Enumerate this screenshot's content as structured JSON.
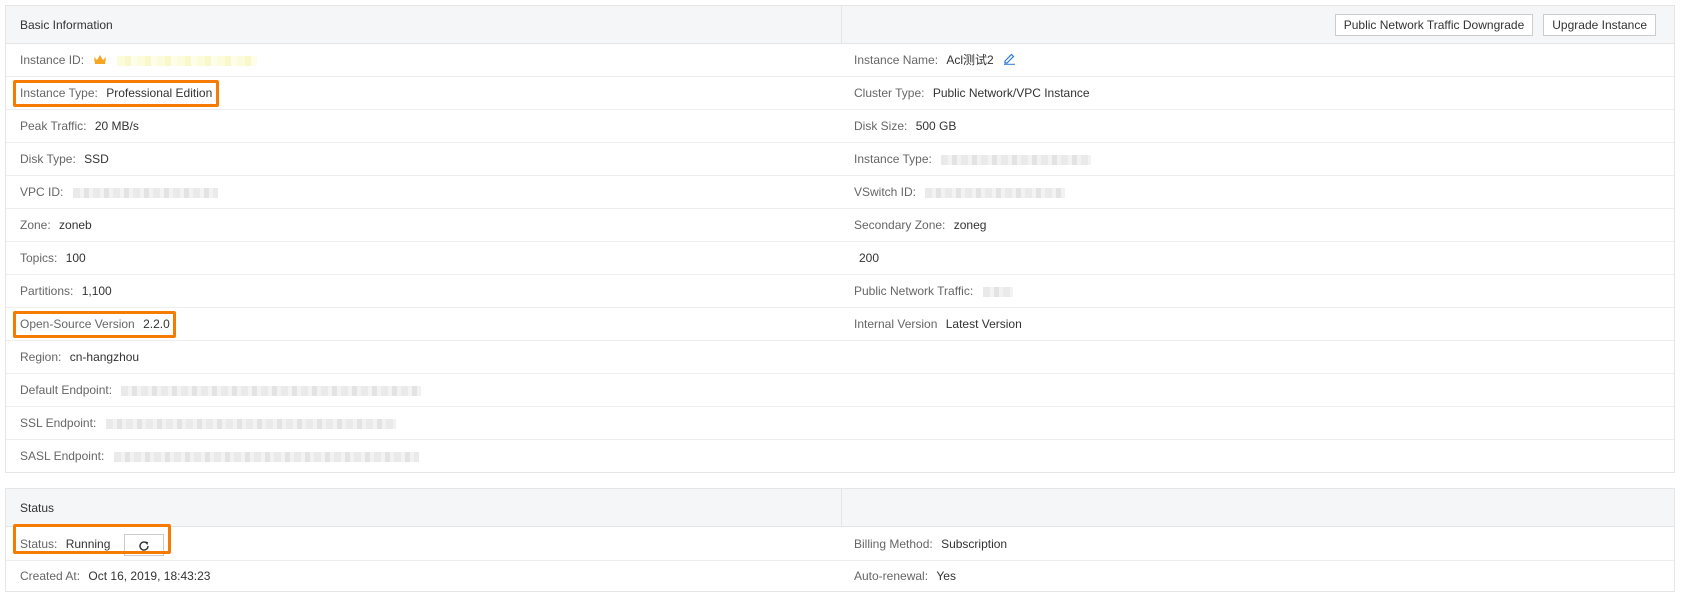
{
  "basic": {
    "title": "Basic Information",
    "actions": {
      "downgrade": "Public Network Traffic Downgrade",
      "upgrade": "Upgrade Instance"
    },
    "rows": [
      {
        "left": {
          "label": "Instance ID:",
          "value": ""
        },
        "right": {
          "label": "Instance Name:",
          "value": "Acl测试2"
        }
      },
      {
        "left": {
          "label": "Instance Type:",
          "value": "Professional Edition"
        },
        "right": {
          "label": "Cluster Type:",
          "value": "Public Network/VPC Instance"
        }
      },
      {
        "left": {
          "label": "Peak Traffic:",
          "value": "20 MB/s"
        },
        "right": {
          "label": "Disk Size:",
          "value": "500 GB"
        }
      },
      {
        "left": {
          "label": "Disk Type:",
          "value": "SSD"
        },
        "right": {
          "label": "Instance Type:",
          "value": ""
        }
      },
      {
        "left": {
          "label": "VPC ID:",
          "value": ""
        },
        "right": {
          "label": "VSwitch ID:",
          "value": ""
        }
      },
      {
        "left": {
          "label": "Zone:",
          "value": "zoneb"
        },
        "right": {
          "label": "Secondary Zone:",
          "value": "zoneg"
        }
      },
      {
        "left": {
          "label": "Topics:",
          "value": "100"
        },
        "right": {
          "label": "",
          "value": "200"
        }
      },
      {
        "left": {
          "label": "Partitions:",
          "value": "1,100"
        },
        "right": {
          "label": "Public Network Traffic:",
          "value": ""
        }
      },
      {
        "left": {
          "label": "Open-Source Version",
          "value": "2.2.0"
        },
        "right": {
          "label": "Internal Version",
          "value": "Latest Version"
        }
      },
      {
        "left": {
          "label": "Region:",
          "value": "cn-hangzhou"
        },
        "right": {
          "label": "",
          "value": ""
        }
      },
      {
        "left": {
          "label": "Default Endpoint:",
          "value": ""
        },
        "right": {
          "label": "",
          "value": ""
        }
      },
      {
        "left": {
          "label": "SSL Endpoint:",
          "value": ""
        },
        "right": {
          "label": "",
          "value": ""
        }
      },
      {
        "left": {
          "label": "SASL Endpoint:",
          "value": ""
        },
        "right": {
          "label": "",
          "value": ""
        }
      }
    ]
  },
  "status": {
    "title": "Status",
    "rows": [
      {
        "left": {
          "label": "Status:",
          "value": "Running"
        },
        "right": {
          "label": "Billing Method:",
          "value": "Subscription"
        }
      },
      {
        "left": {
          "label": "Created At:",
          "value": "Oct 16, 2019, 18:43:23"
        },
        "right": {
          "label": "Auto-renewal:",
          "value": "Yes"
        }
      }
    ]
  },
  "icons": {
    "instance_badge": "crown-icon",
    "edit": "pencil-icon",
    "refresh": "refresh-icon"
  },
  "colors": {
    "highlight": "#f57c00",
    "crown": "#f5a623",
    "edit_icon": "#2f7bd6"
  }
}
